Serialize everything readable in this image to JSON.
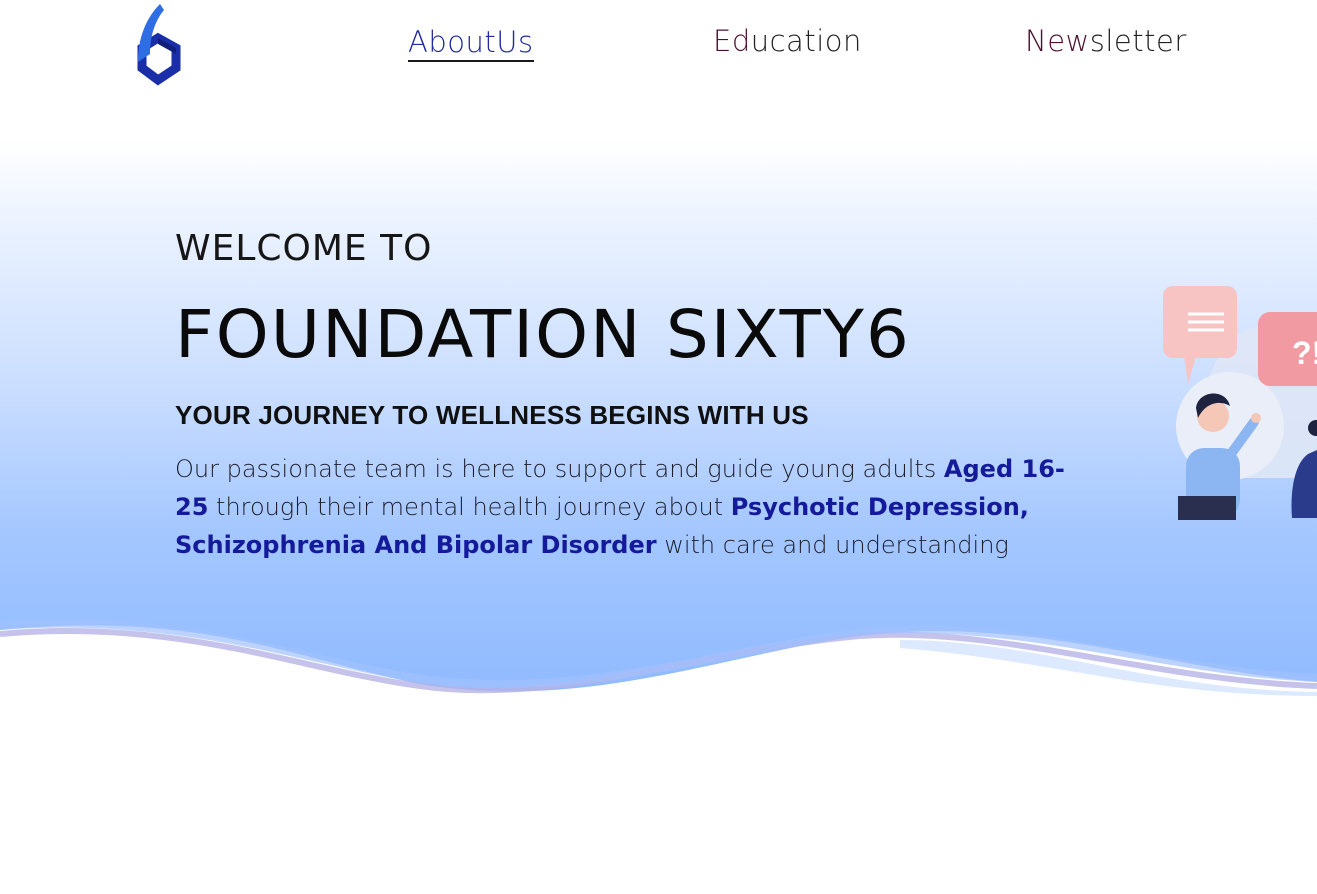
{
  "header": {
    "nav": [
      {
        "first": "A",
        "rest": "boutUs"
      },
      {
        "first": "Ed",
        "rest": "ucation"
      },
      {
        "first": "New",
        "rest": "sletter"
      }
    ]
  },
  "hero": {
    "welcome": "WELCOME TO",
    "title": "FOUNDATION SIXTY6",
    "tagline": "YOUR JOURNEY TO WELLNESS BEGINS WITH US",
    "desc": {
      "part1": "Our passionate team is here to support and guide young adults ",
      "highlight1": "Aged 16-25",
      "part2": " through their mental health journey about ",
      "highlight2": "Psychotic Depression, Schizophrenia And Bipolar Disorder",
      "part3": " with care and understanding"
    },
    "illustration_text": "?!"
  },
  "colors": {
    "brand_blue": "#1f2a9c",
    "nav_accent": "#4b1030",
    "hero_bottom": "#8fbaff"
  }
}
